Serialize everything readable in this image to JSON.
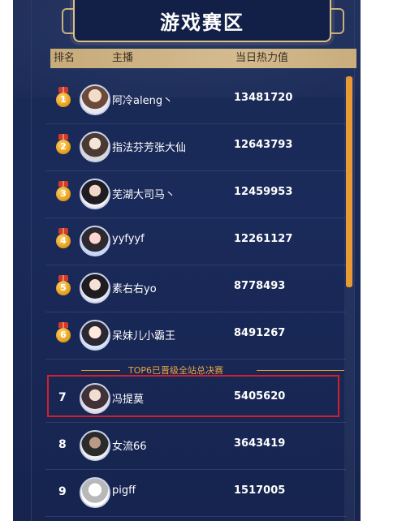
{
  "header": {
    "title": "游戏赛区"
  },
  "table": {
    "columns": {
      "rank": "排名",
      "streamer": "主播",
      "heat": "当日热力值"
    },
    "rows": [
      {
        "rank": "1",
        "name": "阿冷aleng丶",
        "heat": "13481720",
        "medal": true
      },
      {
        "rank": "2",
        "name": "指法芬芳张大仙",
        "heat": "12643793",
        "medal": true
      },
      {
        "rank": "3",
        "name": "芜湖大司马丶",
        "heat": "12459953",
        "medal": true
      },
      {
        "rank": "4",
        "name": "yyfyyf",
        "heat": "12261127",
        "medal": true
      },
      {
        "rank": "5",
        "name": "素右右yo",
        "heat": "8778493",
        "medal": true
      },
      {
        "rank": "6",
        "name": "呆妹儿小霸王",
        "heat": "8491267",
        "medal": true
      },
      {
        "rank": "7",
        "name": "冯提莫",
        "heat": "5405620",
        "medal": false
      },
      {
        "rank": "8",
        "name": "女流66",
        "heat": "3643419",
        "medal": false
      },
      {
        "rank": "9",
        "name": "pigff",
        "heat": "1517005",
        "medal": false
      }
    ]
  },
  "divider": {
    "text": "TOP6已晋级全站总决赛"
  },
  "colors": {
    "panel_bg": "#1a2a5a",
    "header_gold": "#c7ab79",
    "accent_orange": "#e89a33",
    "highlight_red": "#d21f2f"
  }
}
